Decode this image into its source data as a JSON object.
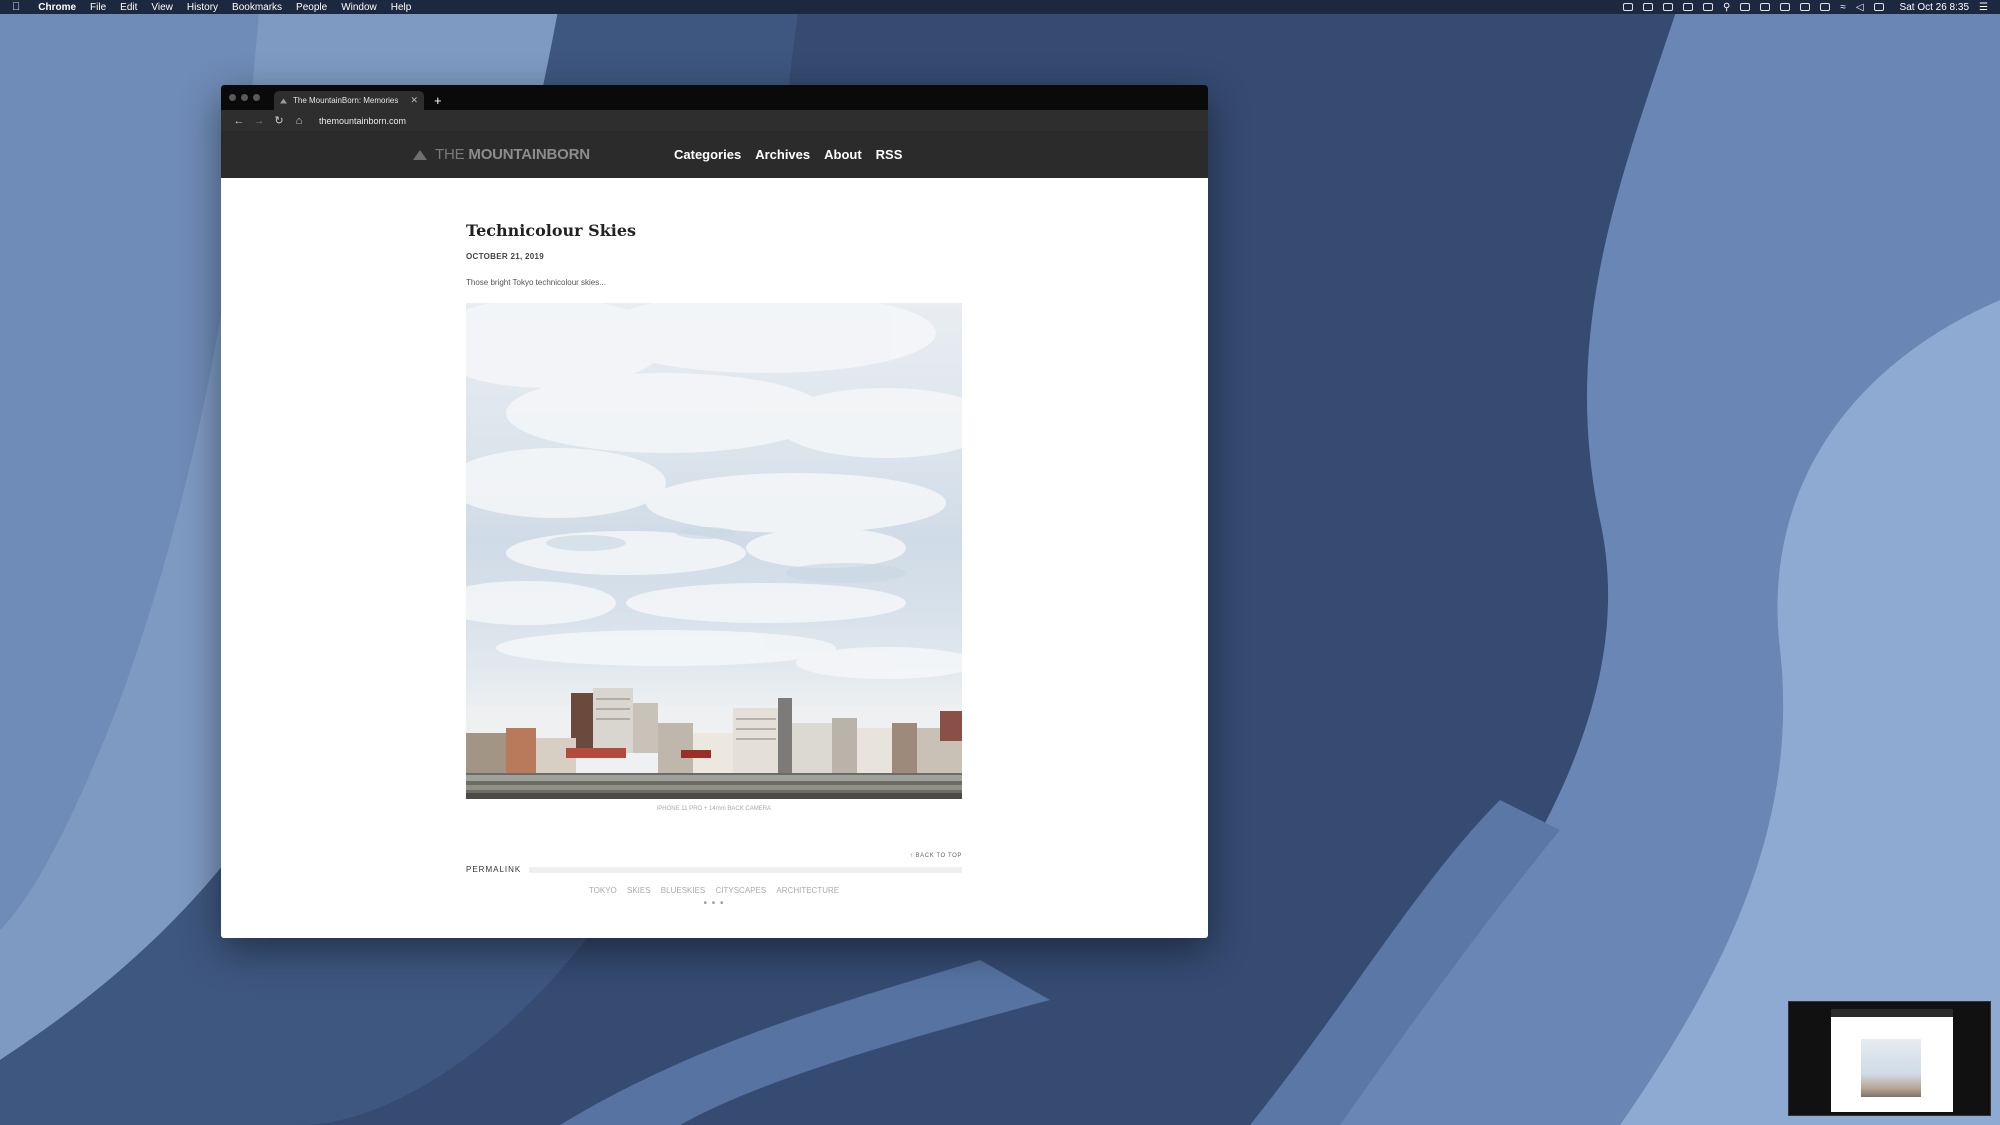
{
  "menubar": {
    "app": "Chrome",
    "items": [
      "File",
      "Edit",
      "View",
      "History",
      "Bookmarks",
      "People",
      "Window",
      "Help"
    ],
    "clock": "Sat Oct 26  8:35"
  },
  "browser": {
    "tab_title": "The MountainBorn: Memories",
    "url": "themountainborn.com"
  },
  "site": {
    "logo_the": "THE",
    "logo_name": "MOUNTAINBORN",
    "nav": [
      "Categories",
      "Archives",
      "About",
      "RSS"
    ]
  },
  "post": {
    "title": "Technicolour Skies",
    "date": "OCTOBER 21, 2019",
    "excerpt": "Those bright Tokyo technicolour skies...",
    "caption": "iPHONE 11 PRO + 14mm BACK CAMERA",
    "back_to_top": "↑ BACK TO TOP",
    "permalink": "PERMALINK",
    "tags": [
      "TOKYO",
      "SKIES",
      "BLUESKIES",
      "CITYSCAPES",
      "ARCHITECTURE"
    ],
    "dots": "• • •"
  },
  "colors": {
    "wallpaper_dark": "#3b5178",
    "wallpaper_light": "#8aa6cf",
    "header_bg": "#2b2b2b"
  }
}
